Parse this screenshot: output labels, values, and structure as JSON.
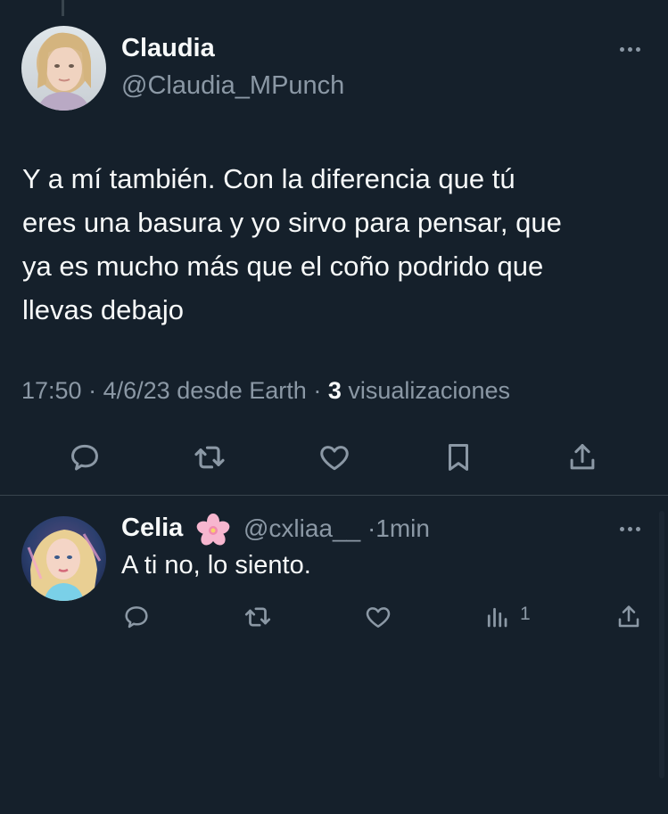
{
  "main_tweet": {
    "display_name": "Claudia",
    "handle": "@Claudia_MPunch",
    "text_lines": [
      "Y a mí también. Con la diferencia que tú",
      "eres una basura y yo sirvo para pensar, que",
      "ya es mucho más que el coño podrido que",
      "llevas debajo"
    ],
    "time": "17:50",
    "date": "4/6/23",
    "source": "desde Earth",
    "separator": "·",
    "views_count": "3",
    "views_label": "visualizaciones",
    "actions": [
      "reply-icon",
      "retweet-icon",
      "like-icon",
      "bookmark-icon",
      "share-icon"
    ]
  },
  "reply_tweet": {
    "display_name": "Celia",
    "emoji": "🌸",
    "handle": "@cxliaa__",
    "separator": "·",
    "time_ago": "1min",
    "text": "A ti no, lo siento.",
    "views_count": "1",
    "actions": [
      "reply-icon",
      "retweet-icon",
      "like-icon",
      "views-icon",
      "share-icon"
    ]
  },
  "colors": {
    "background": "#15202b",
    "text_primary": "#f7f9f9",
    "text_secondary": "#8b98a5",
    "divider": "#38444d"
  }
}
